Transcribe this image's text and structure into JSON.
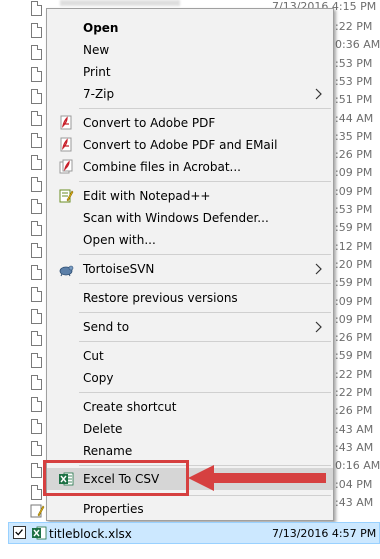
{
  "background": {
    "top_date": "7/13/2016 4:15 PM",
    "time_fragments": [
      ":22 PM",
      "0:36 AM",
      ":53 PM",
      ":53 PM",
      ":51 PM",
      ":44 AM",
      ":35 PM",
      ":26 PM",
      ":09 PM",
      ":09 PM",
      ":53 PM",
      ":59 PM",
      ":12 PM",
      ":20 PM",
      ":59 PM",
      ":09 PM",
      ":09 PM",
      ":26 PM",
      ":59 PM",
      ":22 PM",
      ":22 PM",
      ":26 PM",
      ":43 AM",
      ":43 AM",
      "0:16 AM",
      ":04 PM",
      ":43 AM"
    ]
  },
  "menu": {
    "open": "Open",
    "new": "New",
    "print": "Print",
    "seven_zip": "7-Zip",
    "convert_pdf": "Convert to Adobe PDF",
    "convert_pdf_email": "Convert to Adobe PDF and EMail",
    "combine_acrobat": "Combine files in Acrobat...",
    "edit_notepad": "Edit with Notepad++",
    "scan_defender": "Scan with Windows Defender...",
    "open_with": "Open with...",
    "tortoise": "TortoiseSVN",
    "restore": "Restore previous versions",
    "send_to": "Send to",
    "cut": "Cut",
    "copy": "Copy",
    "create_shortcut": "Create shortcut",
    "delete": "Delete",
    "rename": "Rename",
    "excel_csv": "Excel To CSV",
    "properties": "Properties"
  },
  "selected_file": {
    "name": "titleblock.xlsx",
    "date": "7/13/2016 4:57 PM"
  },
  "colors": {
    "annotation": "#d64040",
    "selection": "#cce8ff",
    "excel_green": "#1e7145"
  }
}
